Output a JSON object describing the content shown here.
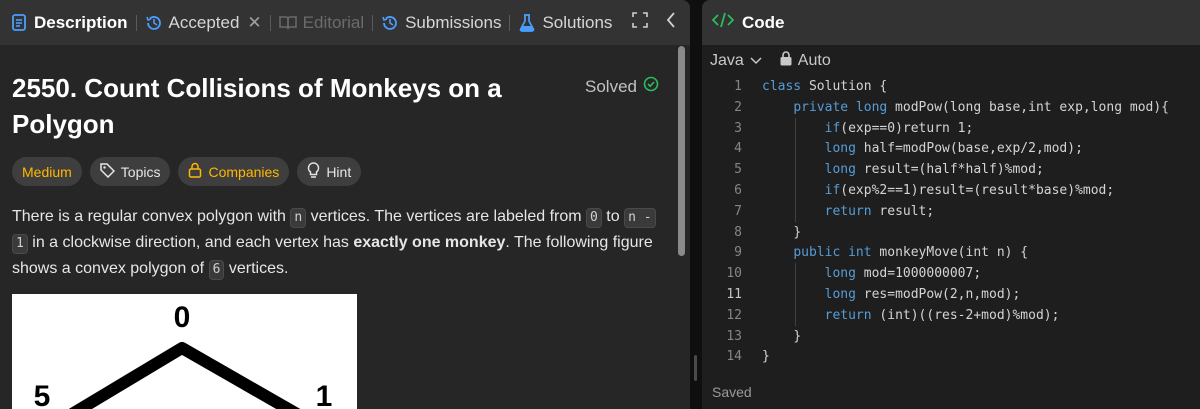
{
  "tabs": {
    "description": "Description",
    "accepted": "Accepted",
    "editorial": "Editorial",
    "submissions": "Submissions",
    "solutions": "Solutions"
  },
  "problem": {
    "title": "2550. Count Collisions of Monkeys on a Polygon",
    "status": "Solved",
    "difficulty": "Medium",
    "chips": {
      "topics": "Topics",
      "companies": "Companies",
      "hint": "Hint"
    },
    "desc": {
      "t1": "There is a regular convex polygon with ",
      "c1": "n",
      "t2": " vertices. The vertices are labeled from ",
      "c2": "0",
      "t3": " to ",
      "c3": "n -",
      "c4": "1",
      "t4": " in a clockwise direction, and each vertex has ",
      "b1": "exactly one monkey",
      "t5": ". The following figure shows a convex polygon of ",
      "c5": "6",
      "t6": " vertices."
    },
    "figure_labels": {
      "top": "0",
      "left": "5",
      "right": "1"
    }
  },
  "editor": {
    "panel_title": "Code",
    "language": "Java",
    "mode": "Auto",
    "status": "Saved",
    "current_line": 11,
    "lines": [
      {
        "n": "1",
        "indent": "",
        "kw": "class",
        "rest": " Solution {"
      },
      {
        "n": "2",
        "indent": "    ",
        "kw": "private long",
        "rest": " modPow(long base,int exp,long mod){"
      },
      {
        "n": "3",
        "indent": "        ",
        "kw": "if",
        "rest": "(exp==0)return 1;"
      },
      {
        "n": "4",
        "indent": "        ",
        "kw": "long",
        "rest": " half=modPow(base,exp/2,mod);"
      },
      {
        "n": "5",
        "indent": "        ",
        "kw": "long",
        "rest": " result=(half*half)%mod;"
      },
      {
        "n": "6",
        "indent": "        ",
        "kw": "if",
        "rest": "(exp%2==1)result=(result*base)%mod;"
      },
      {
        "n": "7",
        "indent": "        ",
        "kw": "return",
        "rest": " result;"
      },
      {
        "n": "8",
        "indent": "    ",
        "kw": "",
        "rest": "}"
      },
      {
        "n": "9",
        "indent": "    ",
        "kw": "public int",
        "rest": " monkeyMove(int n) {"
      },
      {
        "n": "10",
        "indent": "        ",
        "kw": "long",
        "rest": " mod=1000000007;"
      },
      {
        "n": "11",
        "indent": "        ",
        "kw": "long",
        "rest": " res=modPow(2,n,mod);"
      },
      {
        "n": "12",
        "indent": "        ",
        "kw": "return",
        "rest": " (int)((res-2+mod)%mod);"
      },
      {
        "n": "13",
        "indent": "    ",
        "kw": "",
        "rest": "}"
      },
      {
        "n": "14",
        "indent": "",
        "kw": "",
        "rest": "}"
      }
    ]
  },
  "colors": {
    "accent_blue": "#4a9eff",
    "solved_green": "#2cbb5d",
    "medium_yellow": "#ffb800",
    "code_icon_green": "#2cbb5d"
  }
}
